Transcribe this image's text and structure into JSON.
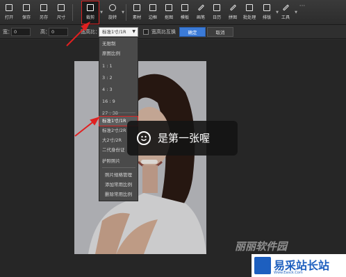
{
  "toolbar": {
    "items": [
      {
        "label": "打开",
        "icon": "folder-open-icon"
      },
      {
        "label": "保存",
        "icon": "save-icon"
      },
      {
        "label": "另存",
        "icon": "save-as-icon"
      },
      {
        "label": "尺寸",
        "icon": "resize-icon"
      },
      {
        "label": "裁剪",
        "icon": "crop-icon",
        "active": true
      },
      {
        "label": "旋转",
        "icon": "rotate-icon"
      },
      {
        "label": "素材",
        "icon": "material-icon"
      },
      {
        "label": "边框",
        "icon": "border-icon"
      },
      {
        "label": "抠图",
        "icon": "cutout-icon"
      },
      {
        "label": "模板",
        "icon": "template-icon"
      },
      {
        "label": "画笔",
        "icon": "brush-icon"
      },
      {
        "label": "日历",
        "icon": "calendar-icon"
      },
      {
        "label": "拼图",
        "icon": "puzzle-icon"
      },
      {
        "label": "批处理",
        "icon": "batch-icon"
      },
      {
        "label": "排版",
        "icon": "layout-icon"
      },
      {
        "label": "工具",
        "icon": "tools-icon"
      }
    ],
    "more": "···"
  },
  "options": {
    "width_label": "宽：",
    "width_value": "0",
    "height_label": "高：",
    "height_value": "0",
    "ratio_label": "宽高比：",
    "ratio_value": "标准1寸/1R",
    "swap_label": "宽高比互换",
    "ok_label": "确定",
    "cancel_label": "取消"
  },
  "menu": {
    "items": [
      "无限制",
      "原图比例",
      "1 : 1",
      "3 : 2",
      "4 : 3",
      "16 : 9",
      "27 : 38"
    ],
    "items2": [
      "标准1寸/1R",
      "标准2寸/2R",
      "大2寸/2R",
      "二代身份证",
      "护照照片"
    ],
    "items3": [
      "照片规格管理",
      "添加常用比例",
      "删除常用比例"
    ]
  },
  "toast": {
    "text": "是第一张喔",
    "icon": "smile-icon"
  },
  "watermark": {
    "brand": "丽丽软件园",
    "logo_text": "易采站长站",
    "logo_sub": "Www.Easck.Com"
  }
}
